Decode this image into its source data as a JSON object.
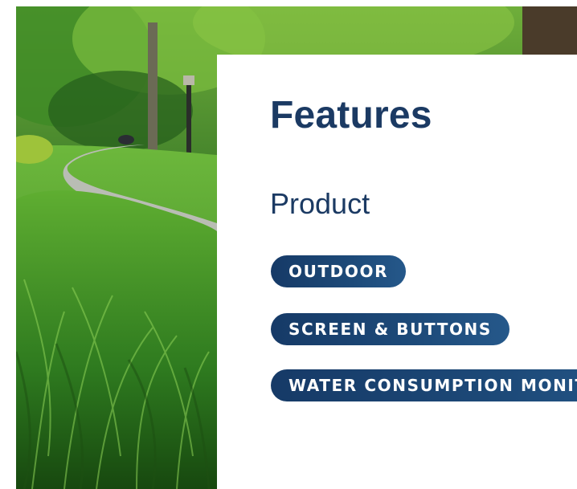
{
  "hero": {
    "image": "park-path-with-grass-and-trees",
    "colors": {
      "foliage": "#3f7a22",
      "path": "#b9bdb4"
    }
  },
  "features": {
    "title": "Features",
    "category": "Product",
    "tags": [
      {
        "label": "OUTDOOR"
      },
      {
        "label": "SCREEN & BUTTONS"
      },
      {
        "label": "WATER CONSUMPTION MONITORING"
      }
    ]
  },
  "theme": {
    "heading_color": "#1b3a63",
    "pill_color": "#1d4a79",
    "pill_text_color": "#ffffff"
  }
}
